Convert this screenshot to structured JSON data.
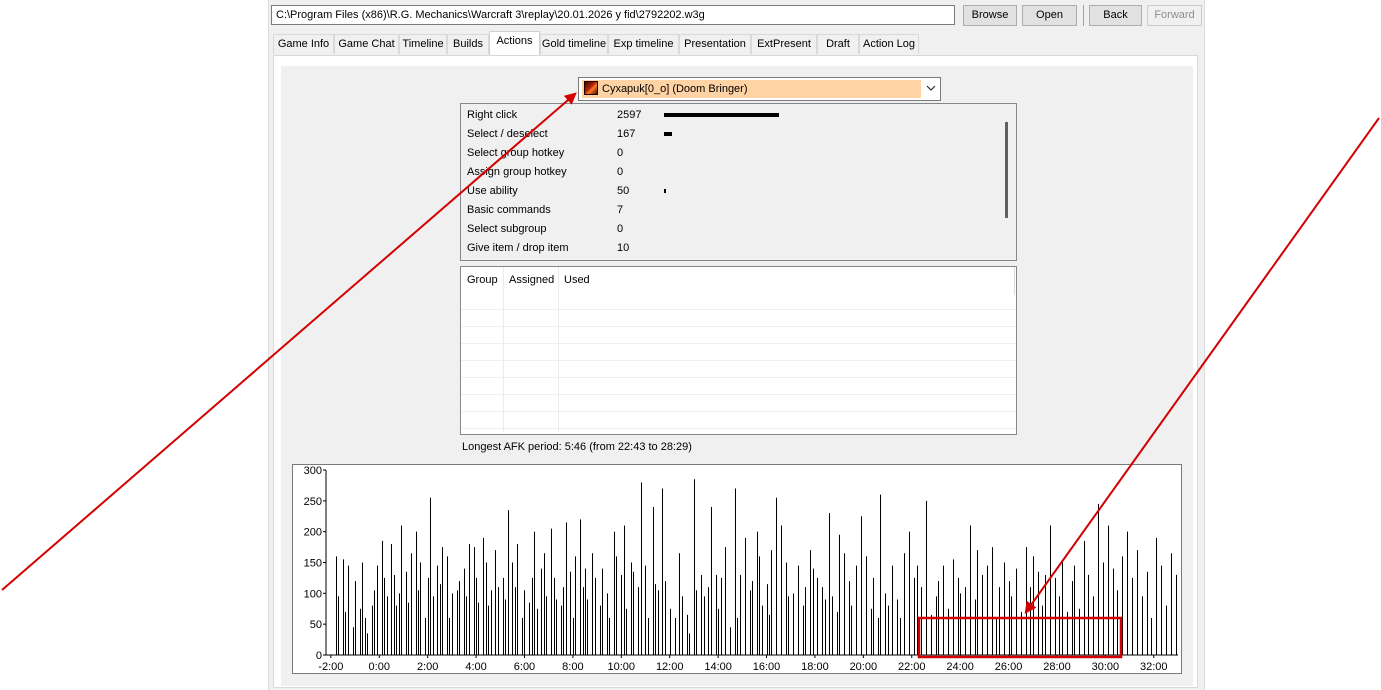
{
  "toolbar": {
    "path_value": "C:\\Program Files (x86)\\R.G. Mechanics\\Warcraft 3\\replay\\20.01.2026 у fid\\2792202.w3g",
    "browse_label": "Browse",
    "open_label": "Open",
    "back_label": "Back",
    "forward_label": "Forward"
  },
  "tabs": [
    {
      "label": "Game Info"
    },
    {
      "label": "Game Chat"
    },
    {
      "label": "Timeline"
    },
    {
      "label": "Builds"
    },
    {
      "label": "Actions",
      "active": true
    },
    {
      "label": "Gold timeline"
    },
    {
      "label": "Exp timeline"
    },
    {
      "label": "Presentation"
    },
    {
      "label": "ExtPresent"
    },
    {
      "label": "Draft"
    },
    {
      "label": "Action Log"
    }
  ],
  "player_select": {
    "selected": "Cyxapuk[0_o] (Doom Bringer)",
    "icon": "doom-guard-hero-icon",
    "highlight_color": "#ffd3a3"
  },
  "actions": [
    {
      "label": "Right click",
      "value": "2597"
    },
    {
      "label": "Select / deselect",
      "value": "167"
    },
    {
      "label": "Select group hotkey",
      "value": "0"
    },
    {
      "label": "Assign group hotkey",
      "value": "0"
    },
    {
      "label": "Use ability",
      "value": "50"
    },
    {
      "label": "Basic commands",
      "value": "7"
    },
    {
      "label": "Select subgroup",
      "value": "0"
    },
    {
      "label": "Give item / drop item",
      "value": "10"
    }
  ],
  "groups_table": {
    "columns": [
      "Group",
      "Assigned",
      "Used"
    ],
    "rows": []
  },
  "afk_text": "Longest AFK period: 5:46 (from 22:43 to 28:29)",
  "annotation": {
    "color": "#d40000"
  },
  "chart_data": {
    "type": "bar",
    "title": "",
    "xlabel": "",
    "ylabel": "",
    "x_ticks": [
      "-2:00",
      "0:00",
      "2:00",
      "4:00",
      "6:00",
      "8:00",
      "10:00",
      "12:00",
      "14:00",
      "16:00",
      "18:00",
      "20:00",
      "22:00",
      "24:00",
      "26:00",
      "28:00",
      "30:00",
      "32:00"
    ],
    "y_ticks": [
      0,
      50,
      100,
      150,
      200,
      250,
      300
    ],
    "xlim_minutes": [
      -2.2,
      33.0
    ],
    "ylim": [
      0,
      300
    ],
    "bar_step_minutes": 0.1,
    "start_minute": -1.9,
    "grid": false,
    "legend": "none",
    "values": [
      0,
      160,
      95,
      0,
      155,
      70,
      145,
      0,
      45,
      120,
      0,
      75,
      150,
      60,
      35,
      0,
      80,
      105,
      145,
      0,
      185,
      125,
      95,
      0,
      180,
      130,
      80,
      100,
      210,
      0,
      135,
      85,
      165,
      0,
      200,
      105,
      150,
      0,
      60,
      125,
      255,
      95,
      0,
      145,
      115,
      175,
      0,
      160,
      60,
      100,
      0,
      105,
      120,
      0,
      140,
      95,
      180,
      0,
      175,
      125,
      85,
      0,
      190,
      150,
      80,
      105,
      0,
      170,
      110,
      0,
      125,
      90,
      235,
      0,
      150,
      110,
      180,
      0,
      60,
      105,
      0,
      85,
      125,
      200,
      75,
      0,
      140,
      165,
      95,
      0,
      205,
      125,
      90,
      0,
      80,
      110,
      215,
      0,
      135,
      60,
      160,
      0,
      220,
      110,
      140,
      90,
      0,
      165,
      125,
      0,
      80,
      140,
      0,
      100,
      60,
      0,
      200,
      160,
      0,
      130,
      210,
      75,
      0,
      150,
      135,
      0,
      110,
      280,
      0,
      145,
      60,
      0,
      240,
      115,
      105,
      0,
      270,
      120,
      0,
      75,
      0,
      60,
      0,
      165,
      95,
      0,
      65,
      35,
      0,
      285,
      105,
      0,
      130,
      95,
      0,
      110,
      240,
      0,
      130,
      75,
      125,
      0,
      175,
      0,
      45,
      0,
      270,
      60,
      130,
      0,
      190,
      0,
      105,
      120,
      0,
      200,
      160,
      80,
      0,
      115,
      65,
      170,
      0,
      255,
      0,
      210,
      0,
      150,
      95,
      0,
      100,
      0,
      145,
      0,
      80,
      110,
      0,
      170,
      140,
      0,
      125,
      0,
      110,
      90,
      0,
      230,
      95,
      0,
      70,
      195,
      0,
      165,
      0,
      120,
      80,
      0,
      145,
      0,
      225,
      0,
      160,
      0,
      75,
      125,
      0,
      60,
      260,
      0,
      100,
      80,
      0,
      145,
      0,
      90,
      60,
      0,
      165,
      0,
      200,
      0,
      125,
      145,
      0,
      110,
      0,
      250,
      0,
      65,
      0,
      95,
      120,
      0,
      145,
      0,
      75,
      0,
      155,
      0,
      125,
      100,
      0,
      110,
      0,
      210,
      0,
      90,
      170,
      0,
      130,
      0,
      145,
      0,
      175,
      0,
      60,
      110,
      0,
      150,
      0,
      120,
      95,
      0,
      140,
      0,
      70,
      0,
      175,
      0,
      110,
      160,
      0,
      135,
      0,
      80,
      130,
      0,
      210,
      0,
      125,
      0,
      95,
      150,
      0,
      70,
      0,
      120,
      145,
      0,
      75,
      0,
      185,
      0,
      130,
      0,
      95,
      0,
      245,
      0,
      150,
      0,
      210,
      0,
      140,
      0,
      105,
      0,
      160,
      0,
      200,
      0,
      125,
      0,
      170,
      0,
      95,
      0,
      135,
      0,
      60,
      0,
      190,
      0,
      145,
      0,
      80,
      0,
      165,
      0,
      130,
      0,
      160,
      0,
      110,
      0,
      150,
      0,
      180,
      0,
      120,
      0,
      270,
      0,
      160,
      0,
      95,
      0,
      140,
      0,
      85,
      0,
      165,
      0,
      110,
      0,
      135,
      0,
      70,
      0,
      105,
      0,
      125,
      0,
      60,
      0,
      90,
      0,
      75,
      0,
      80,
      0,
      105,
      0,
      130,
      0,
      150,
      0,
      60,
      0,
      95,
      0,
      110,
      0,
      80,
      0,
      0,
      0,
      0,
      0,
      48,
      0,
      35,
      0,
      0,
      0,
      0,
      0,
      0,
      0,
      0,
      0,
      0,
      0,
      0,
      0,
      0,
      0,
      0,
      0,
      0,
      0,
      0,
      0,
      0,
      0,
      0,
      0,
      0,
      0,
      0,
      0,
      0,
      0,
      0,
      0,
      0,
      0,
      0,
      0,
      0,
      0,
      0,
      0,
      0,
      0,
      0,
      0,
      0,
      0,
      0,
      0,
      0,
      0,
      0,
      0,
      0,
      0,
      0,
      0,
      0,
      0,
      0,
      0,
      0,
      0,
      10,
      0,
      0,
      0,
      0,
      0,
      0,
      0,
      0,
      0,
      0,
      0,
      60,
      0,
      0,
      0,
      0,
      0,
      0,
      0,
      0,
      0,
      0,
      0,
      45,
      0,
      0,
      165,
      0,
      30,
      0,
      45,
      60,
      0,
      25,
      0,
      50,
      0,
      30,
      0,
      75,
      0,
      55,
      0,
      95,
      0,
      165,
      0,
      190,
      0,
      75,
      0,
      105,
      0,
      60,
      0,
      40
    ]
  }
}
